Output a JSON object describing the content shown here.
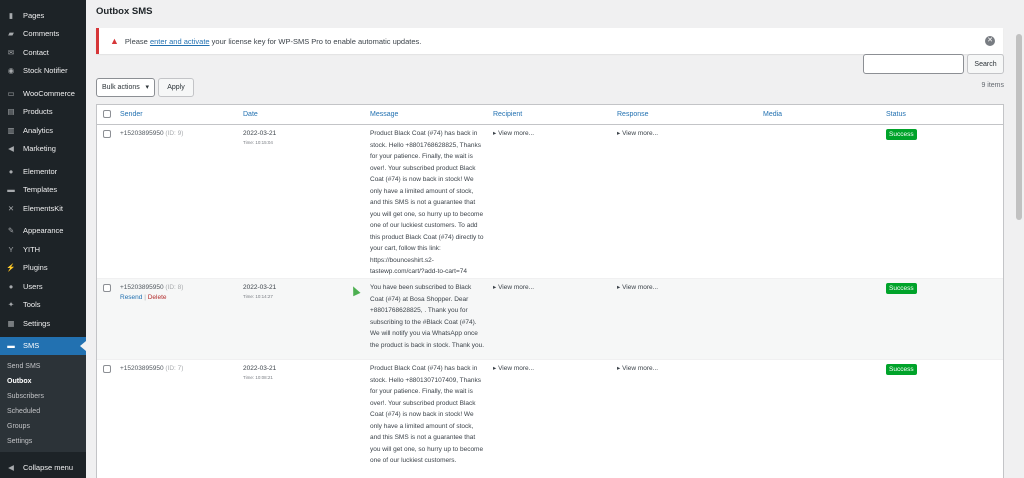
{
  "sidebar": {
    "items": [
      {
        "label": "Pages",
        "icon": "pages-icon",
        "glyph": "▮"
      },
      {
        "label": "Comments",
        "icon": "comments-icon",
        "glyph": "▰"
      },
      {
        "label": "Contact",
        "icon": "mail-icon",
        "glyph": "✉"
      },
      {
        "label": "Stock Notifier",
        "icon": "stock-notifier-icon",
        "glyph": "◉"
      },
      {
        "label": "WooCommerce",
        "icon": "woocommerce-icon",
        "glyph": "▭"
      },
      {
        "label": "Products",
        "icon": "products-icon",
        "glyph": "▤"
      },
      {
        "label": "Analytics",
        "icon": "analytics-icon",
        "glyph": "▥"
      },
      {
        "label": "Marketing",
        "icon": "marketing-icon",
        "glyph": "◀"
      },
      {
        "label": "Elementor",
        "icon": "elementor-icon",
        "glyph": "●"
      },
      {
        "label": "Templates",
        "icon": "templates-icon",
        "glyph": "▬"
      },
      {
        "label": "ElementsKit",
        "icon": "elementskit-icon",
        "glyph": "✕"
      },
      {
        "label": "Appearance",
        "icon": "appearance-icon",
        "glyph": "✎"
      },
      {
        "label": "YITH",
        "icon": "yith-icon",
        "glyph": "Y"
      },
      {
        "label": "Plugins",
        "icon": "plugins-icon",
        "glyph": "⚡"
      },
      {
        "label": "Users",
        "icon": "users-icon",
        "glyph": "●"
      },
      {
        "label": "Tools",
        "icon": "tools-icon",
        "glyph": "✦"
      },
      {
        "label": "Settings",
        "icon": "settings-icon",
        "glyph": "▦"
      },
      {
        "label": "SMS",
        "icon": "sms-icon",
        "glyph": "▬"
      }
    ],
    "submenu": [
      {
        "label": "Send SMS"
      },
      {
        "label": "Outbox"
      },
      {
        "label": "Subscribers"
      },
      {
        "label": "Scheduled"
      },
      {
        "label": "Groups"
      },
      {
        "label": "Settings"
      }
    ],
    "collapse_label": "Collapse menu"
  },
  "page": {
    "title": "Outbox SMS"
  },
  "notice": {
    "prefix": "Please",
    "link": "enter and activate",
    "suffix": "your license key for WP-SMS Pro to enable automatic updates."
  },
  "search": {
    "value": "",
    "button": "Search"
  },
  "bulk": {
    "label": "Bulk actions",
    "apply": "Apply",
    "items_count": "9 items"
  },
  "table": {
    "columns": [
      "Sender",
      "Date",
      "Message",
      "Recipient",
      "Response",
      "Media",
      "Status"
    ],
    "rows": [
      {
        "sender": "+15203895950",
        "id": "(ID: 9)",
        "date": "2022-03-21",
        "time": "Time: 10:15:04",
        "message": "Product Black Coat (#74) has back in stock. Hello +8801768628825, Thanks for your patience. Finally, the wait is over!. Your subscribed product Black Coat (#74) is now back in stock! We only have a limited amount of stock, and this SMS is not a guarantee that you will get one, so hurry up to become one of our luckiest customers. To add this product Black Coat (#74) directly to your cart, follow this link: https://bounceshirt.s2-tastewp.com/cart/?add-to-cart=74",
        "recipient": "▸ View more...",
        "response": "▸ View more...",
        "status": "Success"
      },
      {
        "sender": "+15203895950",
        "id": "(ID: 8)",
        "date": "2022-03-21",
        "time": "Time: 10:14:27",
        "message": "You have been subscribed to Black Coat (#74) at Bosa Shopper. Dear +8801768628825, . Thank you for subscribing to the #Black Coat (#74). We will notify you via WhatsApp once the product is back in stock. Thank you.",
        "recipient": "▸ View more...",
        "response": "▸ View more...",
        "status": "Success",
        "actions": {
          "resend": "Resend",
          "sep": "|",
          "delete": "Delete"
        }
      },
      {
        "sender": "+15203895950",
        "id": "(ID: 7)",
        "date": "2022-03-21",
        "time": "Time: 10:08:21",
        "message": "Product Black Coat (#74) has back in stock. Hello +8801307107409, Thanks for your patience. Finally, the wait is over!. Your subscribed product Black Coat (#74) is now back in stock! We only have a limited amount of stock, and this SMS is not a guarantee that you will get one, so hurry up to become one of our luckiest customers.",
        "recipient": "▸ View more...",
        "response": "▸ View more...",
        "status": "Success"
      }
    ]
  }
}
